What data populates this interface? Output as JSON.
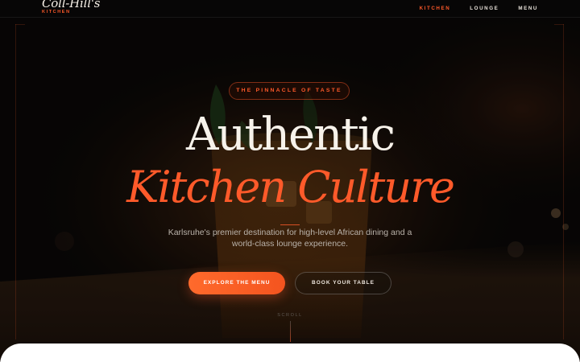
{
  "nav": {
    "brand_name": "Coll-Hill's",
    "brand_sub": "KITCHEN",
    "links": [
      {
        "label": "KITCHEN",
        "active": true
      },
      {
        "label": "LOUNGE",
        "active": false
      },
      {
        "label": "MENU",
        "active": false
      }
    ]
  },
  "hero": {
    "eyebrow": "THE PINNACLE OF TASTE",
    "headline_line1": "Authentic",
    "headline_line2": "Kitchen Culture",
    "subtitle": "Karlsruhe's premier destination for high-level African dining and a world-class lounge experience.",
    "primary_cta": "EXPLORE THE MENU",
    "secondary_cta": "BOOK YOUR TABLE",
    "scroll_label": "SCROLL"
  },
  "colors": {
    "accent": "#ff5a2a",
    "background": "#080706",
    "headline": "#f7f2ea",
    "muted_text": "#b9b2aa"
  }
}
